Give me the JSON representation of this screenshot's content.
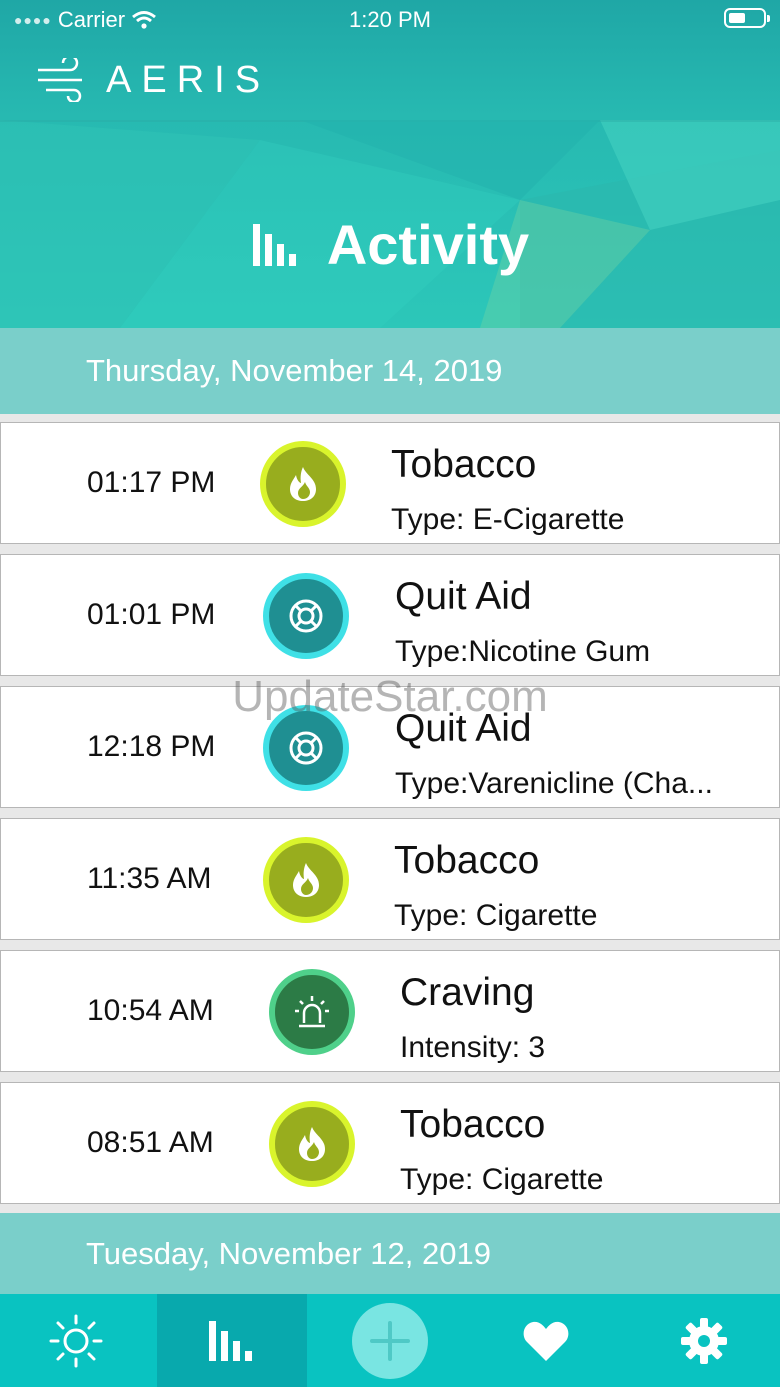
{
  "status_bar": {
    "carrier": "Carrier",
    "time": "1:20 PM"
  },
  "brand": {
    "name": "AERIS"
  },
  "page": {
    "title": "Activity"
  },
  "days": [
    {
      "date": "Thursday, November 14, 2019",
      "entries": [
        {
          "time": "01:17 PM",
          "kind": "tobacco",
          "icon": "flame-icon",
          "title": "Tobacco",
          "detail": "Type: E-Cigarette"
        },
        {
          "time": "01:01 PM",
          "kind": "quit-aid",
          "icon": "lifebuoy-icon",
          "title": "Quit Aid",
          "detail": "Type:Nicotine Gum"
        },
        {
          "time": "12:18 PM",
          "kind": "quit-aid",
          "icon": "lifebuoy-icon",
          "title": "Quit Aid",
          "detail": "Type:Varenicline (Cha..."
        },
        {
          "time": "11:35 AM",
          "kind": "tobacco",
          "icon": "flame-icon",
          "title": "Tobacco",
          "detail": "Type: Cigarette"
        },
        {
          "time": "10:54 AM",
          "kind": "craving",
          "icon": "siren-icon",
          "title": "Craving",
          "detail": "Intensity: 3"
        },
        {
          "time": "08:51 AM",
          "kind": "tobacco",
          "icon": "flame-icon",
          "title": "Tobacco",
          "detail": "Type: Cigarette"
        }
      ]
    },
    {
      "date": "Tuesday, November 12, 2019",
      "entries": []
    }
  ],
  "watermark": "UpdateStar.com",
  "tabbar": {
    "items": [
      {
        "icon": "sun-icon",
        "active": false
      },
      {
        "icon": "bar-chart-icon",
        "active": true
      },
      {
        "icon": "plus-icon",
        "active": false
      },
      {
        "icon": "heart-icon",
        "active": false
      },
      {
        "icon": "gear-icon",
        "active": false
      }
    ]
  },
  "colors": {
    "header_teal": "#27b9b1",
    "date_band": "#7acfca",
    "tabbar": "#09c3c1",
    "tobacco": "#98ad1e",
    "quit_aid": "#1f8f92",
    "craving": "#2c7b46"
  }
}
